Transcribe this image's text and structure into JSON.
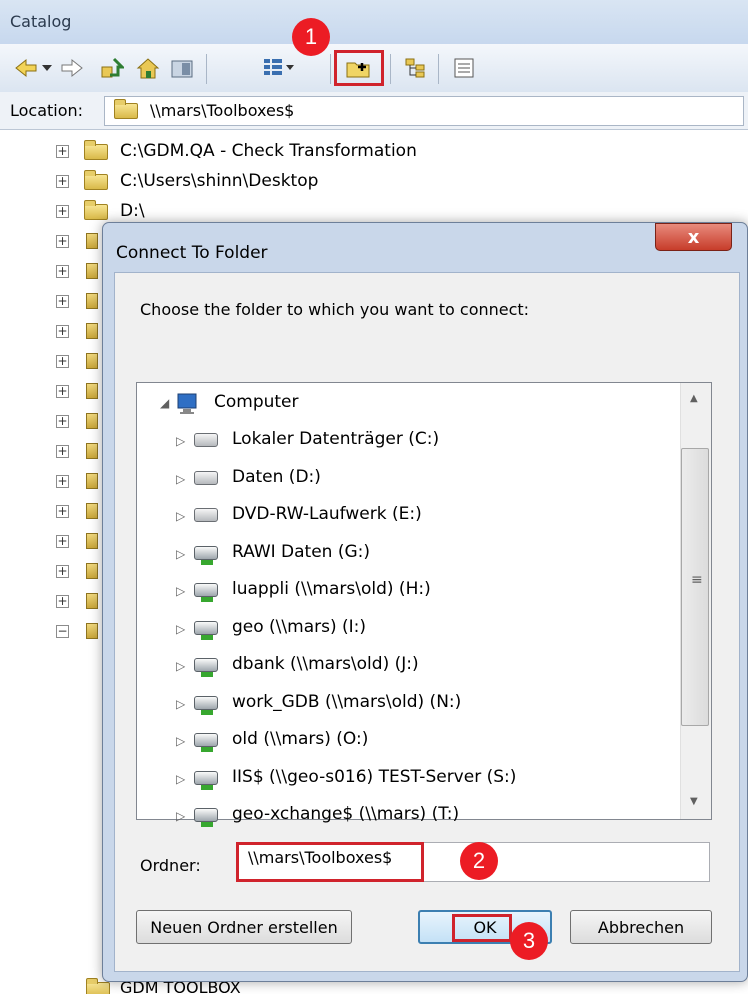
{
  "catalog": {
    "title": "Catalog",
    "location_label": "Location:",
    "location_value": "\\\\mars\\Toolboxes$",
    "tree_items": [
      "C:\\GDM.QA - Check Transformation",
      "C:\\Users\\shinn\\Desktop",
      "D:\\"
    ],
    "bottom_item": "GDM TOOLBOX",
    "toolbar_icons": [
      "back-arrow-icon",
      "dropdown-icon",
      "forward-arrow-icon",
      "up-folder-icon",
      "home-icon",
      "toggle-contents-icon",
      "view-options-icon",
      "connect-folder-icon",
      "tree-view-icon",
      "details-icon"
    ]
  },
  "dialog": {
    "title": "Connect To Folder",
    "close_label": "x",
    "prompt": "Choose the folder to which you want to connect:",
    "root_label": "Computer",
    "items": [
      {
        "label": "Lokaler Datenträger (C:)",
        "icon": "windows-drive-icon"
      },
      {
        "label": "Daten (D:)",
        "icon": "hard-drive-icon"
      },
      {
        "label": "DVD-RW-Laufwerk (E:)",
        "icon": "dvd-drive-icon"
      },
      {
        "label": "RAWI Daten (G:)",
        "icon": "network-drive-icon"
      },
      {
        "label": "luappli (\\\\mars\\old) (H:)",
        "icon": "network-drive-icon"
      },
      {
        "label": "geo (\\\\mars) (I:)",
        "icon": "network-drive-icon"
      },
      {
        "label": "dbank (\\\\mars\\old) (J:)",
        "icon": "network-drive-icon"
      },
      {
        "label": "work_GDB (\\\\mars\\old) (N:)",
        "icon": "network-drive-icon"
      },
      {
        "label": "old (\\\\mars) (O:)",
        "icon": "network-drive-icon"
      },
      {
        "label": "IIS$ (\\\\geo-s016) TEST-Server (S:)",
        "icon": "network-drive-icon"
      },
      {
        "label": "geo-xchange$ (\\\\mars) (T:)",
        "icon": "network-drive-icon"
      }
    ],
    "folder_label": "Ordner:",
    "folder_value": "\\\\mars\\Toolboxes$",
    "new_folder_button": "Neuen Ordner erstellen",
    "ok_button": "OK",
    "cancel_button": "Abbrechen"
  },
  "annotations": {
    "step1": "1",
    "step2": "2",
    "step3": "3",
    "color": "#ec1c24"
  }
}
